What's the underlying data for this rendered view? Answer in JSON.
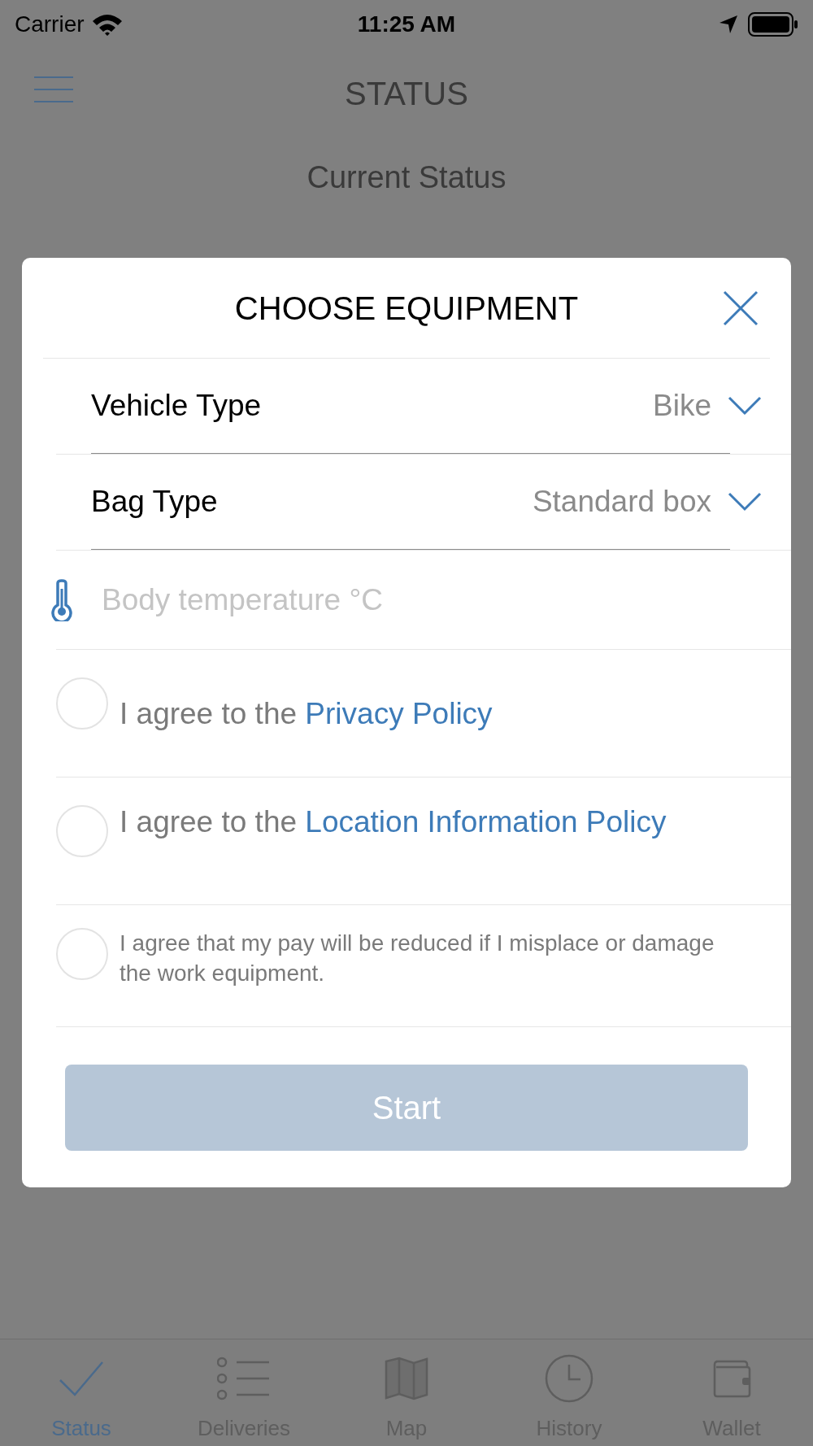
{
  "status_bar": {
    "carrier": "Carrier",
    "time": "11:25 AM"
  },
  "header": {
    "title": "STATUS"
  },
  "status": {
    "label": "Current Status"
  },
  "dialog": {
    "title": "CHOOSE EQUIPMENT",
    "selects": [
      {
        "label": "Vehicle Type",
        "value": "Bike"
      },
      {
        "label": "Bag Type",
        "value": "Standard box"
      }
    ],
    "temperature": {
      "placeholder": "Body temperature °C"
    },
    "agreements": [
      {
        "text": "I agree to the ",
        "link": "Privacy Policy",
        "checked": false,
        "kind": "large"
      },
      {
        "text": "I agree to the ",
        "link": "Location Information Policy",
        "checked": false,
        "kind": "large"
      },
      {
        "text": "I agree that my pay will be reduced if I misplace or damage the work equipment.",
        "checked": false,
        "kind": "small"
      }
    ],
    "button": {
      "label": "Start",
      "disabled": true
    }
  },
  "tabs": [
    {
      "label": "Status",
      "selected": true,
      "kind": "check"
    },
    {
      "label": "Deliveries",
      "selected": false,
      "kind": "list"
    },
    {
      "label": "Map",
      "selected": false,
      "kind": "map"
    },
    {
      "label": "History",
      "selected": false,
      "kind": "clock"
    },
    {
      "label": "Wallet",
      "selected": false,
      "kind": "wallet"
    }
  ]
}
